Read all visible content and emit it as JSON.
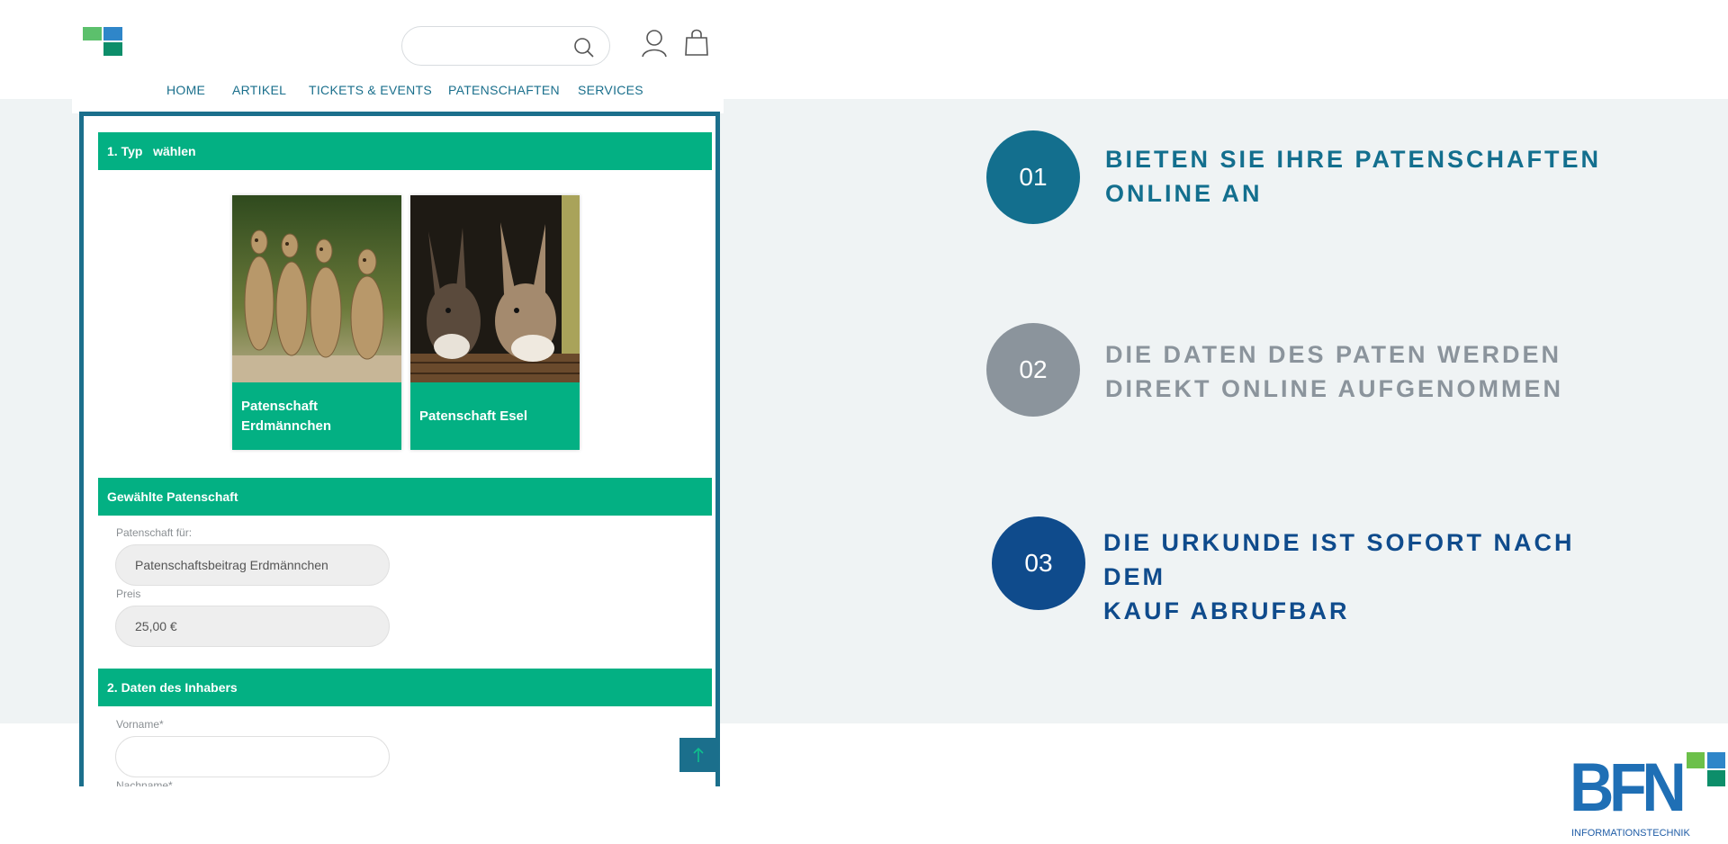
{
  "colors": {
    "teal_nav": "#1a6f8c",
    "green_bar": "#03b083",
    "step1": "#136f8e",
    "step2": "#8b949c",
    "step3": "#0f4b8c",
    "band": "#eff3f4"
  },
  "shop": {
    "logo": "shop-logo-mark",
    "search": {
      "placeholder": ""
    },
    "nav": [
      "HOME",
      "ARTIKEL",
      "TICKETS & EVENTS",
      "PATENSCHAFTEN",
      "SERVICES"
    ]
  },
  "form": {
    "section1": "1. Typ   wählen",
    "cards": [
      {
        "caption": "Patenschaft Erdmännchen",
        "image": "meerkats-photo"
      },
      {
        "caption": "Patenschaft Esel",
        "image": "donkeys-photo"
      }
    ],
    "section_selected": "Gewählte Patenschaft",
    "sponsor_for_label": "Patenschaft für:",
    "sponsor_for_value": "Patenschaftsbeitrag Erdmännchen",
    "price_label": "Preis",
    "price_value": "25,00 €",
    "section2": "2. Daten des Inhabers",
    "firstname_label": "Vorname*",
    "firstname_value": "",
    "lastname_label": "Nachname*"
  },
  "steps": [
    {
      "number": "01",
      "line1": "BIETEN SIE IHRE PATENSCHAFTEN",
      "line2": "ONLINE AN"
    },
    {
      "number": "02",
      "line1": "DIE DATEN DES PATEN WERDEN",
      "line2": "DIREKT ONLINE AUFGENOMMEN"
    },
    {
      "number": "03",
      "line1": "DIE URKUNDE IST SOFORT NACH DEM",
      "line2": "KAUF ABRUFBAR"
    }
  ],
  "brand": {
    "name": "BFN",
    "tagline": "INFORMATIONSTECHNIK"
  }
}
